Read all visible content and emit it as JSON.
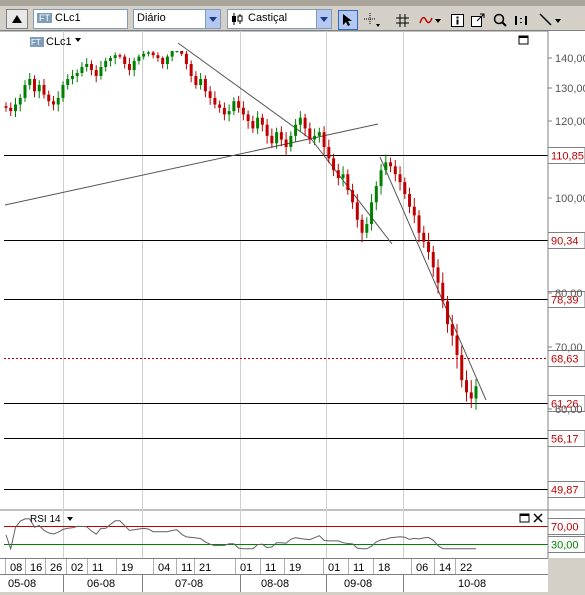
{
  "toolbar": {
    "symbol": "CLc1",
    "symbol_badge": "FT",
    "interval": "Diário",
    "chart_style": "Castiçal"
  },
  "chart": {
    "symbol_label": "CLc1",
    "symbol_badge": "FT",
    "price_axis": [
      "140,00",
      "130,00",
      "120,00",
      "100,00",
      "80,00",
      "70,00",
      "60,00"
    ],
    "lines": [
      {
        "value": 110.85,
        "label": "110,85",
        "style": "solid"
      },
      {
        "value": 90.34,
        "label": "90,34",
        "style": "solid"
      },
      {
        "value": 78.39,
        "label": "78,39",
        "style": "solid"
      },
      {
        "value": 68.63,
        "label": "68,63",
        "style": "dotted"
      },
      {
        "value": 61.26,
        "label": "61,26",
        "style": "solid"
      },
      {
        "value": 56.17,
        "label": "56,17",
        "style": "solid"
      },
      {
        "value": 49.87,
        "label": "49,87",
        "style": "solid"
      }
    ],
    "rsi_label": "RSI 14",
    "rsi_levels": [
      {
        "value": 70,
        "label": "70,00"
      },
      {
        "value": 30,
        "label": "30,00"
      }
    ],
    "days": [
      "08",
      "16",
      "26",
      "02",
      "11",
      "19",
      "04",
      "11",
      "21",
      "01",
      "11",
      "19",
      "01",
      "11",
      "18",
      "06",
      "14",
      "22"
    ],
    "months": [
      "05-08",
      "06-08",
      "07-08",
      "08-08",
      "09-08",
      "10-08"
    ],
    "colors": {
      "up": "#008000",
      "down": "#c00000",
      "level_label": "#c00000",
      "rsi70": "#c00000",
      "rsi30": "#008000"
    }
  },
  "chart_data": {
    "type": "candlestick",
    "symbol": "CLc1",
    "interval": "Diário",
    "horizontal_levels": [
      110.85,
      90.34,
      78.39,
      68.63,
      61.26,
      56.17,
      49.87
    ],
    "rsi_period": 14,
    "rsi_levels": [
      70,
      30
    ],
    "closes": [
      124,
      123,
      125,
      127,
      131,
      133,
      129,
      131,
      128,
      126,
      125,
      127,
      131,
      133,
      134,
      135,
      137,
      138,
      136,
      134,
      137,
      139,
      140,
      142,
      141,
      138,
      136,
      139,
      141,
      143,
      144,
      142,
      140,
      138,
      141,
      145,
      147,
      143,
      138,
      134,
      131,
      133,
      129,
      127,
      125,
      124,
      122,
      123,
      126,
      124,
      122,
      120,
      118,
      121,
      119,
      116,
      114,
      117,
      115,
      113,
      116,
      119,
      121,
      118,
      115,
      116,
      117,
      113,
      110,
      107,
      105,
      106,
      102,
      99,
      95,
      92,
      94,
      99,
      103,
      107,
      109,
      108,
      106,
      104,
      101,
      98,
      96,
      92,
      90,
      88,
      85,
      82,
      78,
      74,
      72,
      69,
      65,
      63,
      62,
      64
    ]
  }
}
